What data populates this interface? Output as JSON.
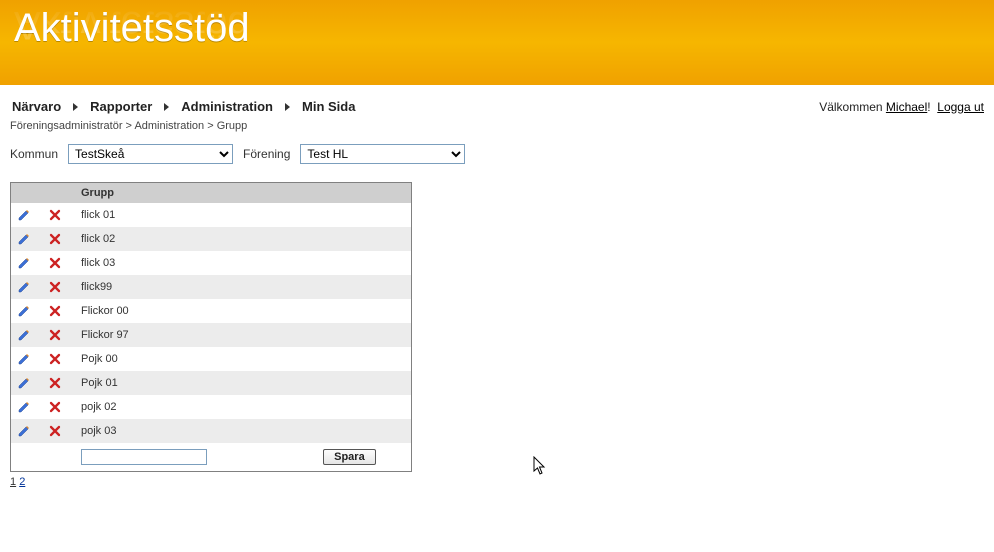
{
  "app": {
    "title": "Aktivitetsstöd"
  },
  "nav": {
    "items": [
      "Närvaro",
      "Rapporter",
      "Administration",
      "Min Sida"
    ]
  },
  "welcome": {
    "prefix": "Välkommen ",
    "user": "Michael",
    "exclaim": "!",
    "logout": "Logga ut"
  },
  "breadcrumb": {
    "parts": [
      "Föreningsadministratör",
      "Administration",
      "Grupp"
    ],
    "sep": " > "
  },
  "filters": {
    "kommun_label": "Kommun",
    "kommun_value": "TestSkeå",
    "forening_label": "Förening",
    "forening_value": "Test HL"
  },
  "table": {
    "header": "Grupp",
    "rows": [
      {
        "name": "flick 01"
      },
      {
        "name": "flick 02"
      },
      {
        "name": "flick 03"
      },
      {
        "name": "flick99"
      },
      {
        "name": "Flickor 00"
      },
      {
        "name": "Flickor 97"
      },
      {
        "name": "Pojk 00"
      },
      {
        "name": "Pojk 01"
      },
      {
        "name": "pojk 02"
      },
      {
        "name": "pojk 03"
      }
    ],
    "new_value": "",
    "save_label": "Spara"
  },
  "pager": {
    "current": "1",
    "other": "2"
  },
  "icons": {
    "edit": "pencil-icon",
    "delete": "delete-icon"
  },
  "colors": {
    "banner": "#f0a100",
    "th_bg": "#cfcfcf",
    "row_alt": "#ececec"
  }
}
